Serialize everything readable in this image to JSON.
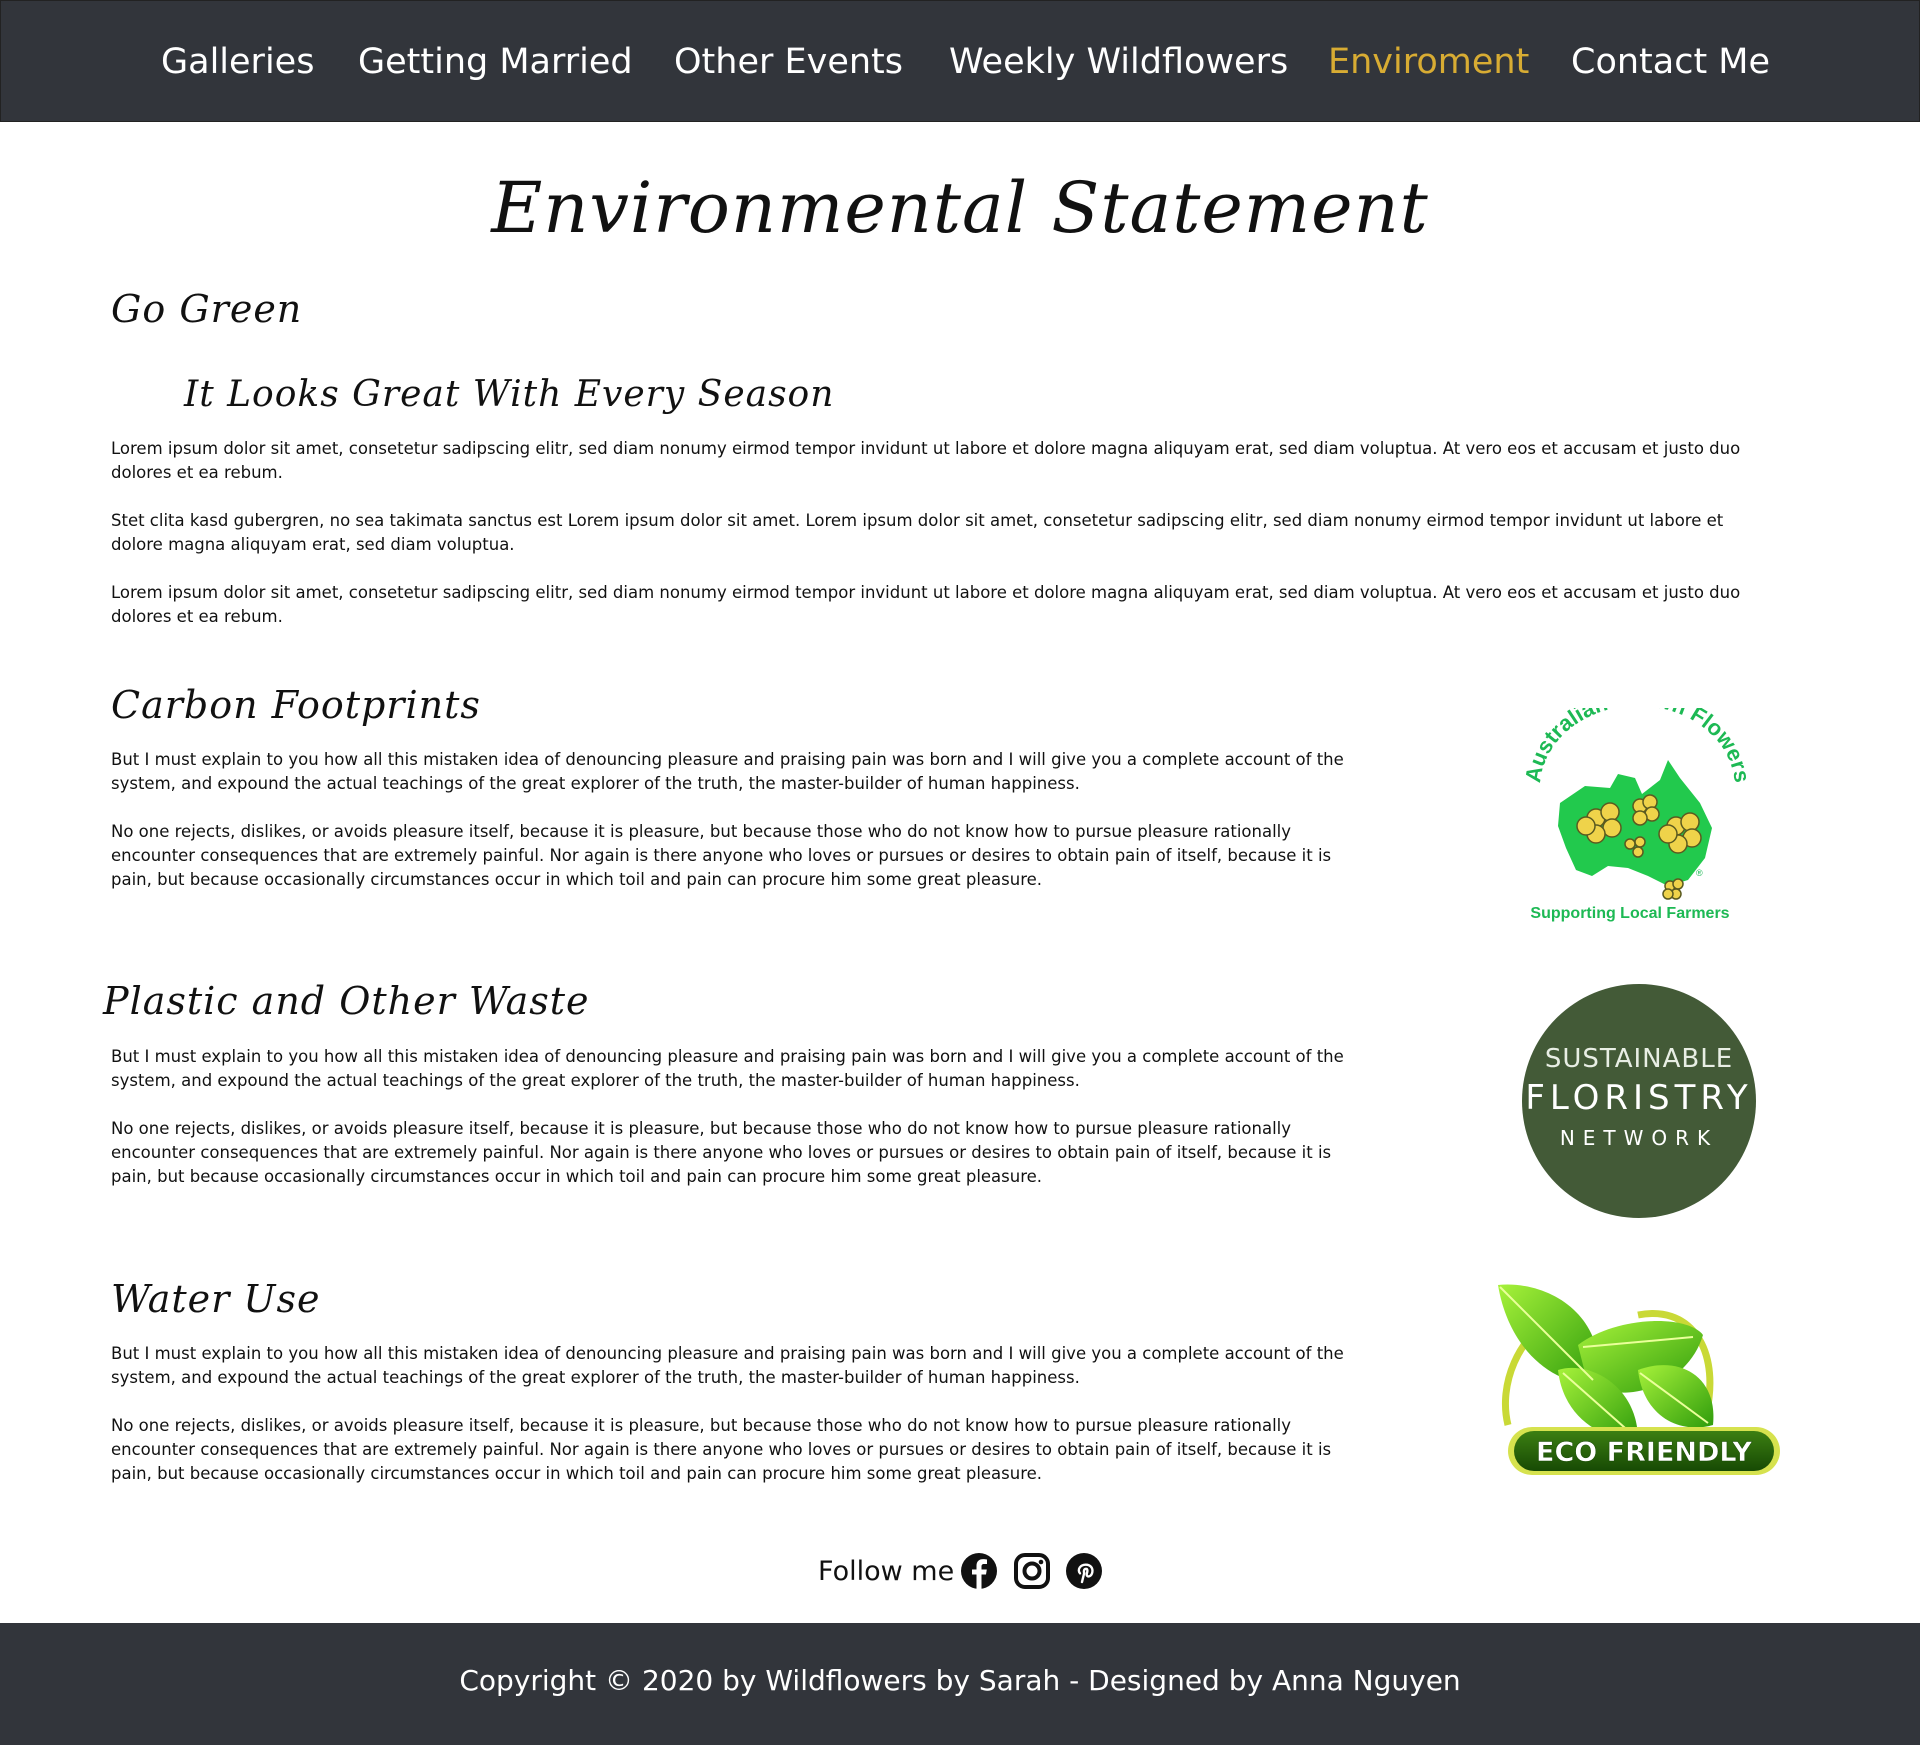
{
  "nav": {
    "items": [
      {
        "label": "Galleries"
      },
      {
        "label": "Getting Married"
      },
      {
        "label": "Other Events"
      },
      {
        "label": "Weekly Wildflowers"
      },
      {
        "label": "Enviroment"
      },
      {
        "label": "Contact Me"
      }
    ],
    "active_index": 4,
    "active_color": "#d8ac33",
    "background": "#32353b"
  },
  "main": {
    "title": "Environmental Statement",
    "sections": [
      {
        "heading": "Go Green",
        "subheading": "It Looks Great With Every Season",
        "paragraphs": [
          "Lorem ipsum dolor sit amet, consetetur sadipscing elitr, sed diam nonumy eirmod tempor invidunt ut labore et dolore magna aliquyam erat, sed diam voluptua. At vero eos et accusam et justo duo dolores et ea rebum.",
          "Stet clita kasd gubergren, no sea takimata sanctus est Lorem ipsum dolor sit amet. Lorem ipsum dolor sit amet, consetetur sadipscing elitr, sed diam nonumy eirmod tempor invidunt ut labore et dolore magna aliquyam erat, sed diam voluptua.",
          "Lorem ipsum dolor sit amet, consetetur sadipscing elitr, sed diam nonumy eirmod tempor invidunt ut labore et dolore magna aliquyam erat, sed diam voluptua. At vero eos et accusam et justo duo dolores et ea rebum."
        ]
      },
      {
        "heading": "Carbon Footprints",
        "paragraphs": [
          "But I must explain to you how all this mistaken idea of denouncing pleasure and praising pain was born and I will give you a complete account of the system, and expound the actual teachings of the great explorer of the truth, the master-builder of human happiness.",
          "No one rejects, dislikes, or avoids pleasure itself, because it is pleasure, but because those who do not know how to pursue pleasure rationally encounter consequences that are extremely painful. Nor again is there anyone who loves or pursues or desires to obtain pain of itself, because it is pain, but because occasionally circumstances occur in which toil and pain can procure him some great pleasure."
        ]
      },
      {
        "heading": "Plastic and Other Waste",
        "paragraphs": [
          "But I must explain to you how all this mistaken idea of denouncing pleasure and praising pain was born and I will give you a complete account of the system, and expound the actual teachings of the great explorer of the truth, the master-builder of human happiness.",
          "No one rejects, dislikes, or avoids pleasure itself, because it is pleasure, but because those who do not know how to pursue pleasure rationally encounter consequences that are extremely painful. Nor again is there anyone who loves or pursues or desires to obtain pain of itself, because it is pain, but because occasionally circumstances occur in which toil and pain can procure him some great pleasure."
        ]
      },
      {
        "heading": "Water Use",
        "paragraphs": [
          "But I must explain to you how all this mistaken idea of denouncing pleasure and praising pain was born and I will give you a complete account of the system, and expound the actual teachings of the great explorer of the truth, the master-builder of human happiness.",
          "No one rejects, dislikes, or avoids pleasure itself, because it is pleasure, but because those who do not know how to pursue pleasure rationally encounter consequences that are extremely painful. Nor again is there anyone who loves or pursues or desires to obtain pain of itself, because it is pain, but because occasionally circumstances occur in which toil and pain can procure him some great pleasure."
        ]
      }
    ]
  },
  "logos": {
    "australian_grown": {
      "arc_text": "Australian Grown Flowers",
      "tagline": "Supporting Local Farmers",
      "registered": "®",
      "color": "#1db954"
    },
    "sustainable_floristry": {
      "line1": "SUSTAINABLE",
      "line2": "FLORISTRY",
      "line3": "NETWORK",
      "color": "#435a37"
    },
    "eco_friendly": {
      "label": "ECO FRIENDLY",
      "color": "#2f6d0e"
    }
  },
  "follow": {
    "label": "Follow me",
    "icons": [
      "facebook-icon",
      "instagram-icon",
      "pinterest-icon"
    ]
  },
  "footer": {
    "copyright": "Copyright © 2020 by Wildflowers by Sarah - Designed by Anna Nguyen"
  }
}
